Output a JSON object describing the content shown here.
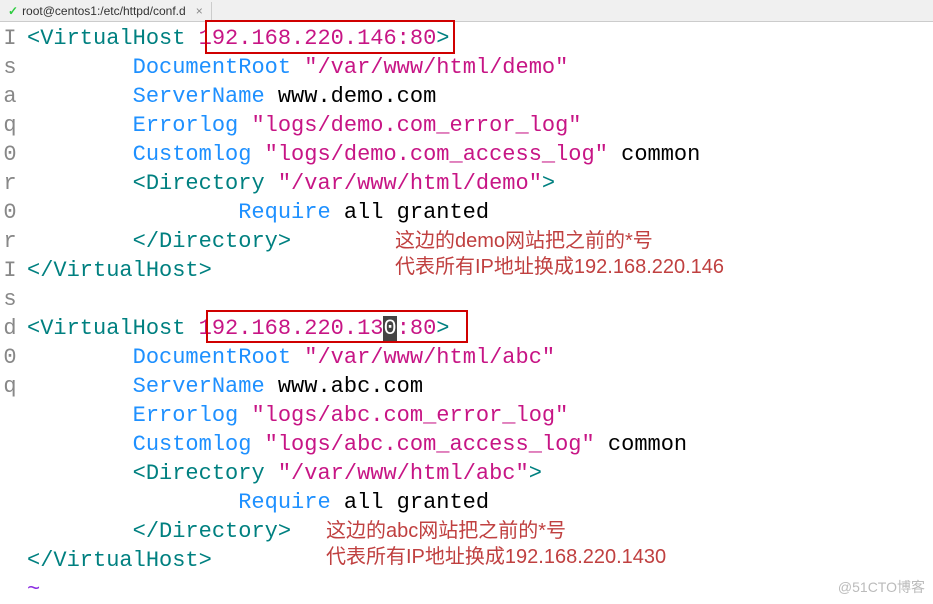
{
  "tab": {
    "icon": "✓",
    "title": "root@centos1:/etc/httpd/conf.d",
    "close": "×"
  },
  "gutter": [
    "I",
    "s",
    "a",
    "q",
    "0",
    "r",
    "0",
    "r",
    " ",
    "I",
    "s",
    "d",
    "0",
    "q",
    " ",
    " ",
    " ",
    " ",
    " ",
    " "
  ],
  "code": {
    "vh1": {
      "open_tag": "VirtualHost",
      "open_ip": "192.168.220.146:80",
      "docroot_k": "DocumentRoot",
      "docroot_v": "\"/var/www/html/demo\"",
      "servername_k": "ServerName",
      "servername_v": "www.demo.com",
      "errorlog_k": "Errorlog",
      "errorlog_v": "\"logs/demo.com_error_log\"",
      "customlog_k": "Customlog",
      "customlog_v": "\"logs/demo.com_access_log\"",
      "customlog_fmt": "common",
      "dir_open": "Directory",
      "dir_open_v": "\"/var/www/html/demo\"",
      "require_k": "Require",
      "require_v": "all granted",
      "dir_close": "Directory",
      "close_tag": "VirtualHost"
    },
    "vh2": {
      "open_tag": "VirtualHost",
      "open_ip_a": "192.168.220.13",
      "open_ip_cursor": "0",
      "open_ip_b": ":80",
      "docroot_k": "DocumentRoot",
      "docroot_v": "\"/var/www/html/abc\"",
      "servername_k": "ServerName",
      "servername_v": "www.abc.com",
      "errorlog_k": "Errorlog",
      "errorlog_v": "\"logs/abc.com_error_log\"",
      "customlog_k": "Customlog",
      "customlog_v": "\"logs/abc.com_access_log\"",
      "customlog_fmt": "common",
      "dir_open": "Directory",
      "dir_open_v": "\"/var/www/html/abc\"",
      "require_k": "Require",
      "require_v": "all granted",
      "dir_close": "Directory",
      "close_tag": "VirtualHost"
    },
    "tilde": "~"
  },
  "annotations": {
    "a1_line1": "这边的demo网站把之前的*号",
    "a1_line2": "代表所有IP地址换成192.168.220.146",
    "a2_line1": "这边的abc网站把之前的*号",
    "a2_line2": "代表所有IP地址换成192.168.220.1430"
  },
  "watermark": "@51CTO博客"
}
